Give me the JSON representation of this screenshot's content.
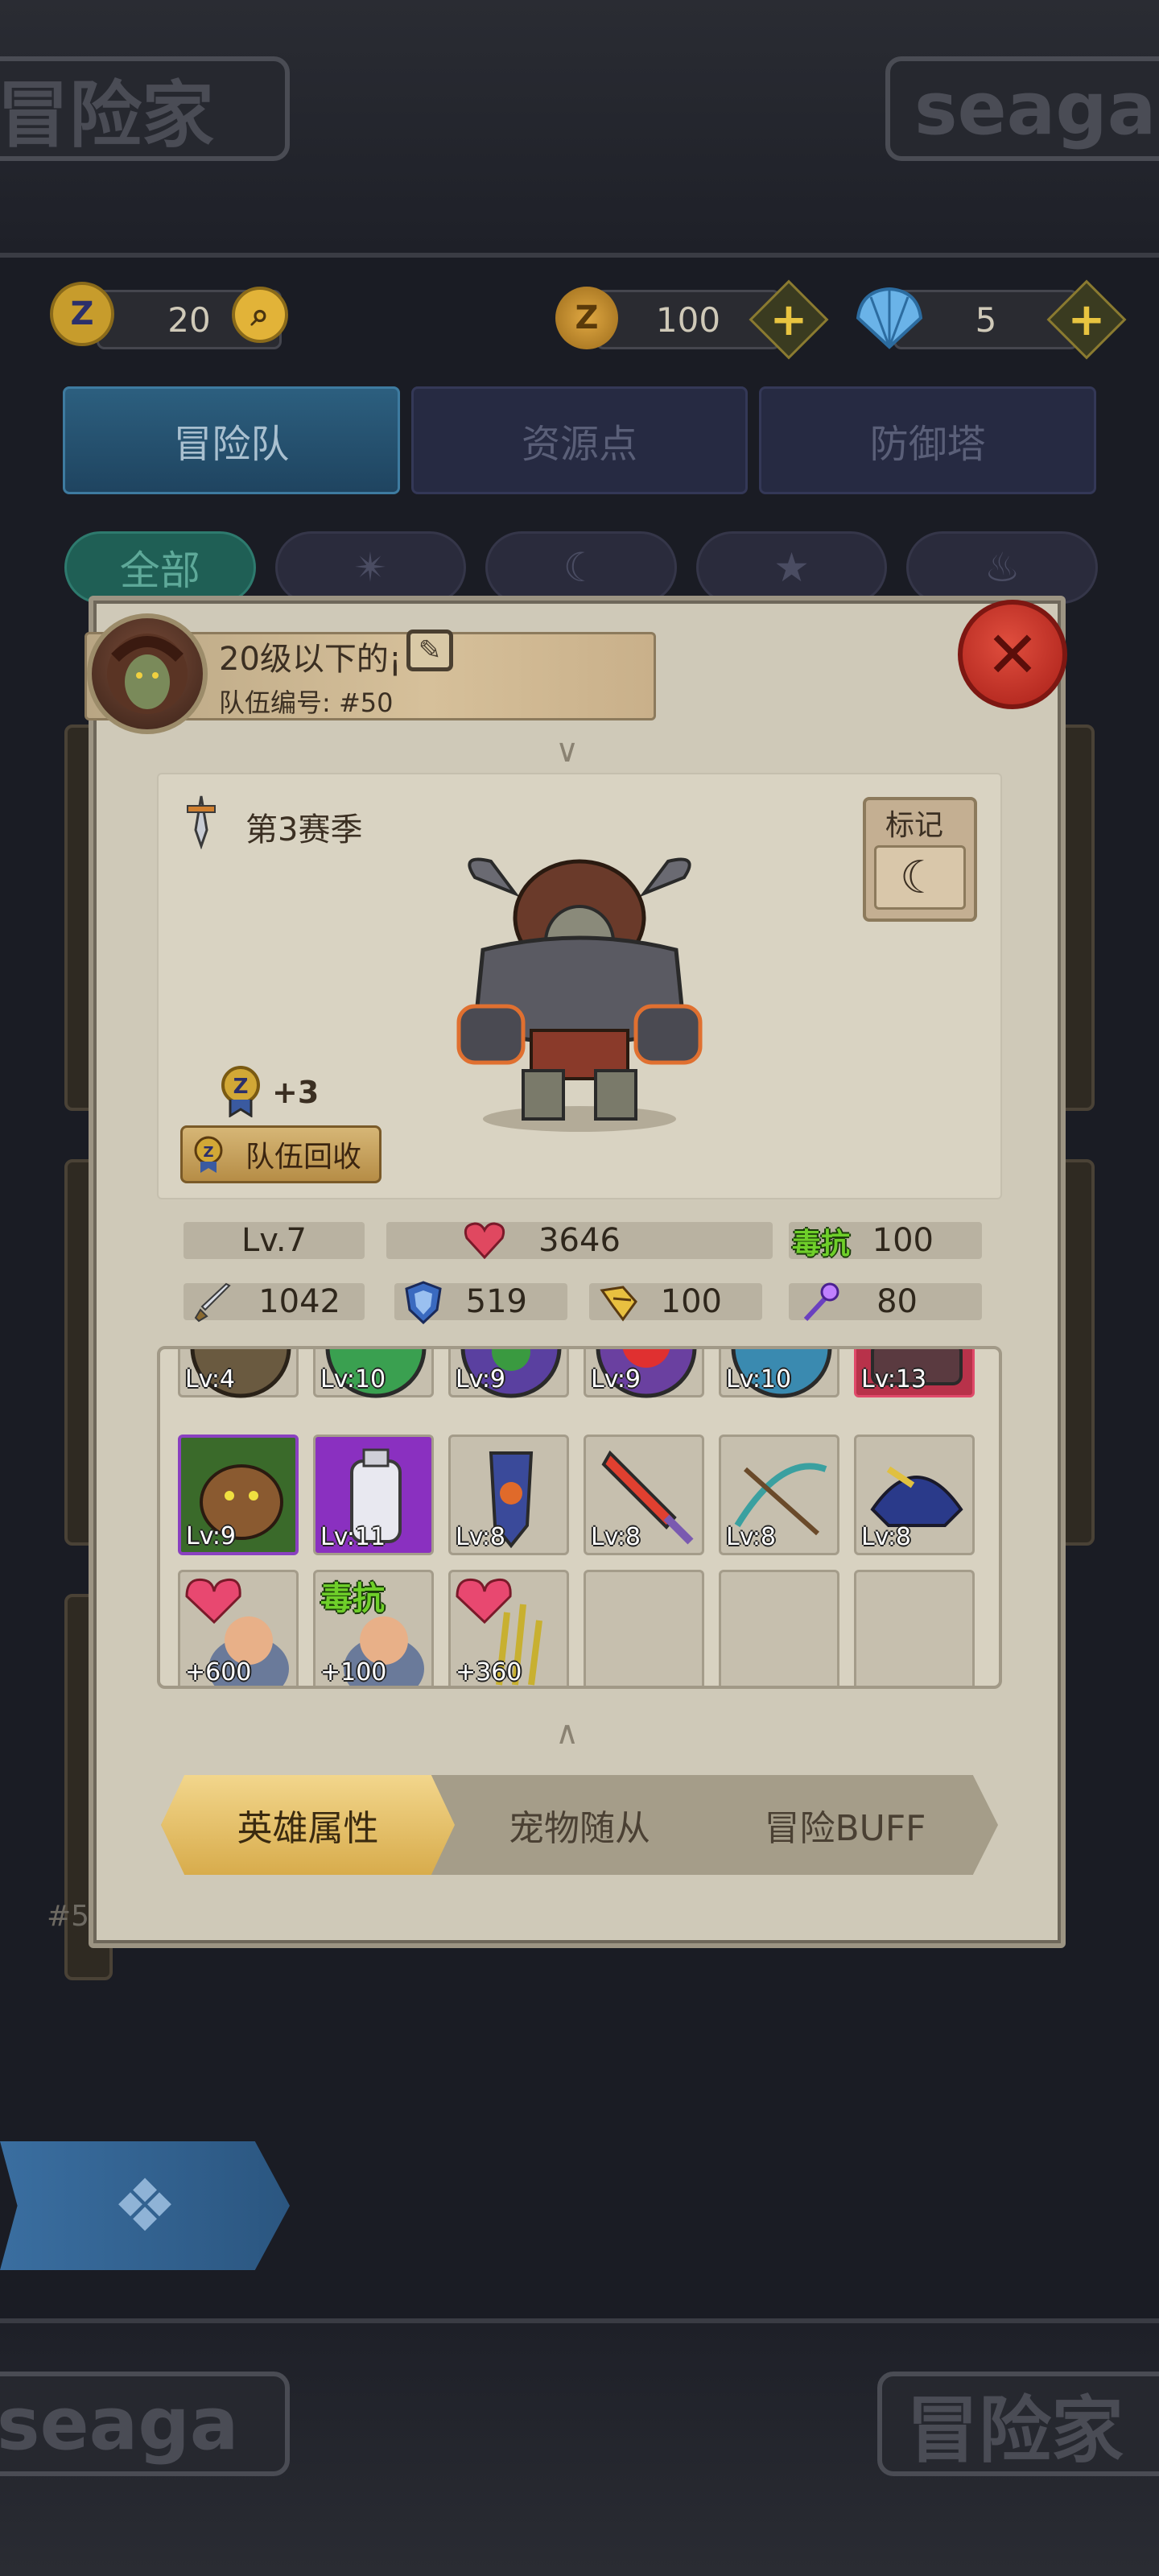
{
  "top_banner": {
    "left_text": "冒险家",
    "right_text": "seaga"
  },
  "bottom_banner": {
    "left_text": "seaga",
    "right_text": "冒险家"
  },
  "currency": {
    "tokens": "20",
    "coins": "100",
    "shells": "5"
  },
  "tabs": [
    {
      "label": "冒险队",
      "active": true
    },
    {
      "label": "资源点",
      "active": false
    },
    {
      "label": "防御塔",
      "active": false
    }
  ],
  "filters": [
    {
      "label": "全部",
      "icon": "all",
      "active": true
    },
    {
      "label": "",
      "icon": "sparkle-icon",
      "active": false
    },
    {
      "label": "",
      "icon": "moon-icon",
      "active": false
    },
    {
      "label": "",
      "icon": "star-icon",
      "active": false
    },
    {
      "label": "",
      "icon": "flame-icon",
      "active": false
    }
  ],
  "team": {
    "name": "20级以下的¡",
    "id_label": "队伍编号: #50"
  },
  "season": "第3赛季",
  "mark_label": "标记",
  "mark_icon": "moon-icon",
  "token_bonus": "+3",
  "recycle_label": "队伍回收",
  "stats": {
    "level": "Lv.7",
    "hp": "3646",
    "poison_label": "毒抗",
    "poison": "100",
    "attack": "1042",
    "defense": "519",
    "speed": "100",
    "magic": "80"
  },
  "grid_row1": [
    "Lv:4",
    "Lv:10",
    "Lv:9",
    "Lv:9",
    "Lv:10",
    "Lv:13"
  ],
  "grid_row2": [
    "Lv:9",
    "Lv:11",
    "Lv:8",
    "Lv:8",
    "Lv:8",
    "Lv:8"
  ],
  "grid_row3": {
    "labels": [
      "+600",
      "+100",
      "+360"
    ],
    "badge": "毒抗"
  },
  "bottom_tabs": [
    {
      "label": "英雄属性",
      "active": true
    },
    {
      "label": "宠物随从",
      "active": false
    },
    {
      "label": "冒险BUFF",
      "active": false
    }
  ],
  "side_number": "#5",
  "colors": {
    "accent_gold": "#d8ac4c",
    "close_red": "#c8372c",
    "poison_green": "#6fcf2a",
    "tab_blue": "#2c5f7f"
  }
}
